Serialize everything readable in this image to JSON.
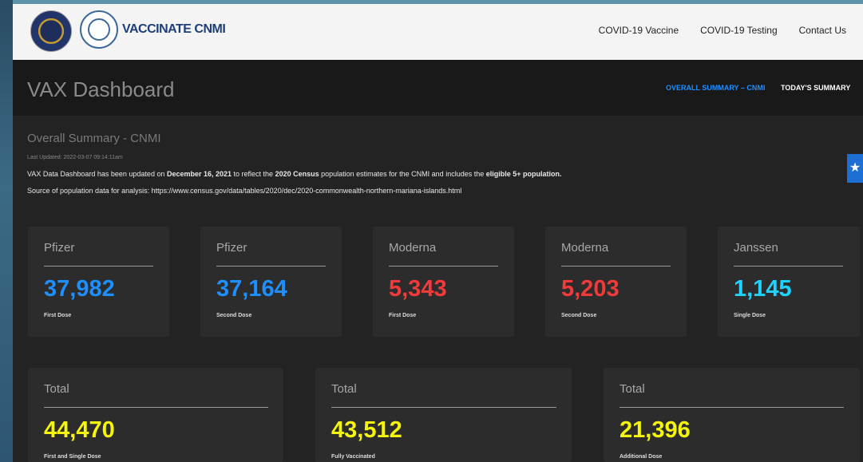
{
  "nav": {
    "brand": "VACCINATE CNMI",
    "links": [
      "COVID-19 Vaccine",
      "COVID-19 Testing",
      "Contact Us"
    ]
  },
  "header": {
    "title": "VAX Dashboard",
    "tabs": [
      "OVERALL SUMMARY – CNMI",
      "TODAY'S SUMMARY"
    ]
  },
  "summary": {
    "title": "Overall Summary - CNMI",
    "last_updated": "Last Updated: 2022-03-07 09:14:11am",
    "notice": {
      "p1": "VAX Data Dashboard has been updated on ",
      "b1": "December 16, 2021",
      "p2": " to reflect the ",
      "b2": "2020 Census",
      "p3": " population estimates for the CNMI and includes the ",
      "b3": "eligible 5+ population."
    },
    "source": "Source of population data for analysis: https://www.census.gov/data/tables/2020/dec/2020-commonwealth-northern-mariana-islands.html"
  },
  "cards": [
    {
      "label": "Pfizer",
      "value": "37,982",
      "sub": "First Dose",
      "color": "#1e8fff"
    },
    {
      "label": "Pfizer",
      "value": "37,164",
      "sub": "Second Dose",
      "color": "#1e8fff"
    },
    {
      "label": "Moderna",
      "value": "5,343",
      "sub": "First Dose",
      "color": "#f23a3a"
    },
    {
      "label": "Moderna",
      "value": "5,203",
      "sub": "Second Dose",
      "color": "#f23a3a"
    },
    {
      "label": "Janssen",
      "value": "1,145",
      "sub": "Single Dose",
      "color": "#1fd2ff"
    }
  ],
  "totals": [
    {
      "label": "Total",
      "value": "44,470",
      "sub": "First and Single Dose",
      "color": "#f5f50a"
    },
    {
      "label": "Total",
      "value": "43,512",
      "sub": "Fully Vaccinated",
      "color": "#f5f50a"
    },
    {
      "label": "Total",
      "value": "21,396",
      "sub": "Additional Dose",
      "color": "#f5f50a"
    }
  ],
  "icons": {
    "accessibility": "accessibility-icon"
  }
}
